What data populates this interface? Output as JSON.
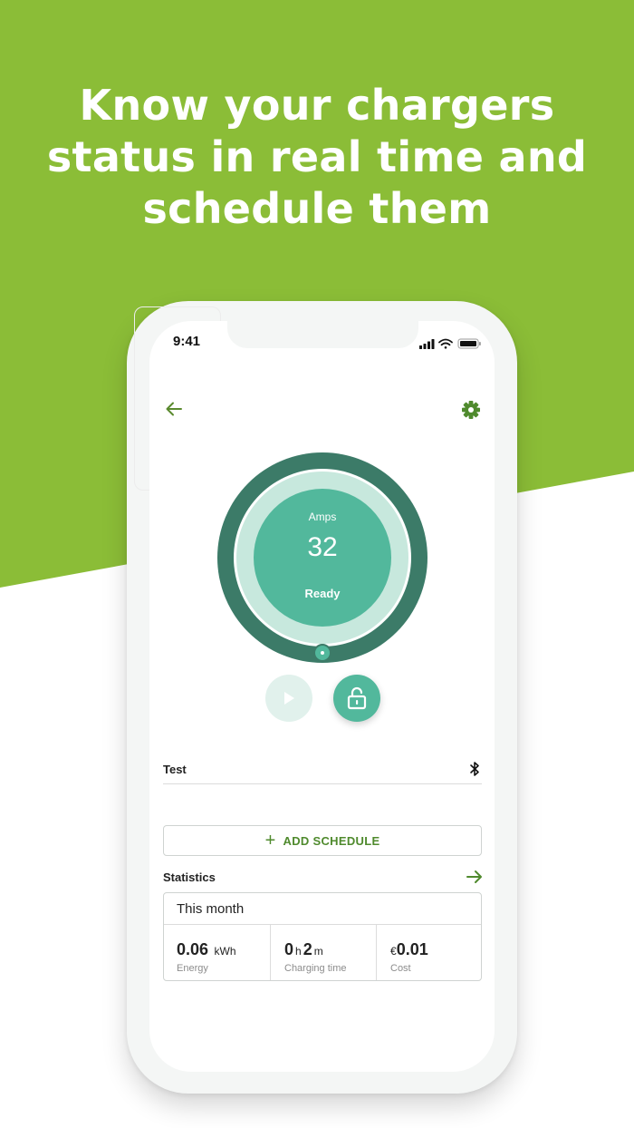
{
  "headline": {
    "line1": "Know your chargers",
    "line2": "status in real time and",
    "line3": "schedule them"
  },
  "colors": {
    "brand_green": "#8bbd37",
    "gauge_dark": "#3c7b68",
    "gauge_light": "#c7e8dd",
    "gauge_fill": "#52b89c",
    "accent_text": "#4f8a2d"
  },
  "status_bar": {
    "time": "9:41"
  },
  "nav": {
    "back_icon": "arrow-left-icon",
    "settings_icon": "gear-icon"
  },
  "gauge": {
    "label": "Amps",
    "value": "32",
    "state": "Ready"
  },
  "controls": {
    "play_icon": "play-icon",
    "lock_icon": "unlock-icon"
  },
  "charger": {
    "name": "Test",
    "connection_icon": "bluetooth-icon"
  },
  "schedule": {
    "add_label": "ADD SCHEDULE"
  },
  "statistics": {
    "title": "Statistics",
    "period": "This month",
    "energy": {
      "value": "0.06",
      "unit": "kWh",
      "caption": "Energy"
    },
    "charging_time": {
      "hours": "0",
      "hours_unit": "h",
      "minutes": "2",
      "minutes_unit": "m",
      "caption": "Charging time"
    },
    "cost": {
      "currency": "€",
      "value": "0.01",
      "caption": "Cost"
    }
  }
}
